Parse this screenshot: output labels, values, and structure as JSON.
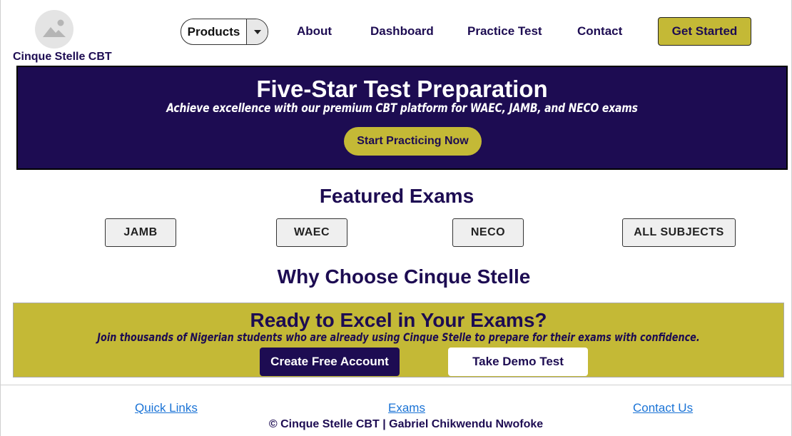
{
  "header": {
    "logo_icon": "image-placeholder-icon",
    "brand": "Cinque Stelle CBT",
    "products_label": "Products",
    "nav": {
      "about": "About",
      "dashboard": "Dashboard",
      "practice_test": "Practice Test",
      "contact": "Contact"
    },
    "cta_label": "Get Started"
  },
  "hero": {
    "title": "Five-Star Test Preparation",
    "subtitle": "Achieve excellence with our premium CBT platform for WAEC, JAMB, and NECO exams",
    "button": "Start Practicing Now"
  },
  "featured": {
    "title": "Featured Exams",
    "exams": [
      "JAMB",
      "WAEC",
      "NECO",
      "ALL SUBJECTS"
    ]
  },
  "why": {
    "title": "Why Choose Cinque Stelle"
  },
  "cta": {
    "title": "Ready to Excel in Your Exams?",
    "subtitle": "Join thousands of Nigerian students who are already using Cinque Stelle to prepare for their exams with confidence.",
    "primary_button": "Create Free Account",
    "secondary_button": "Take Demo Test"
  },
  "footer": {
    "links": {
      "quick_links": "Quick Links",
      "exams": "Exams",
      "contact_us": "Contact Us"
    },
    "copyright": "© Cinque Stelle CBT | Gabriel Chikwendu Nwofoke"
  },
  "colors": {
    "brand_navy": "#1d0c52",
    "brand_gold": "#c4b936",
    "link_blue": "#1a73d6"
  }
}
